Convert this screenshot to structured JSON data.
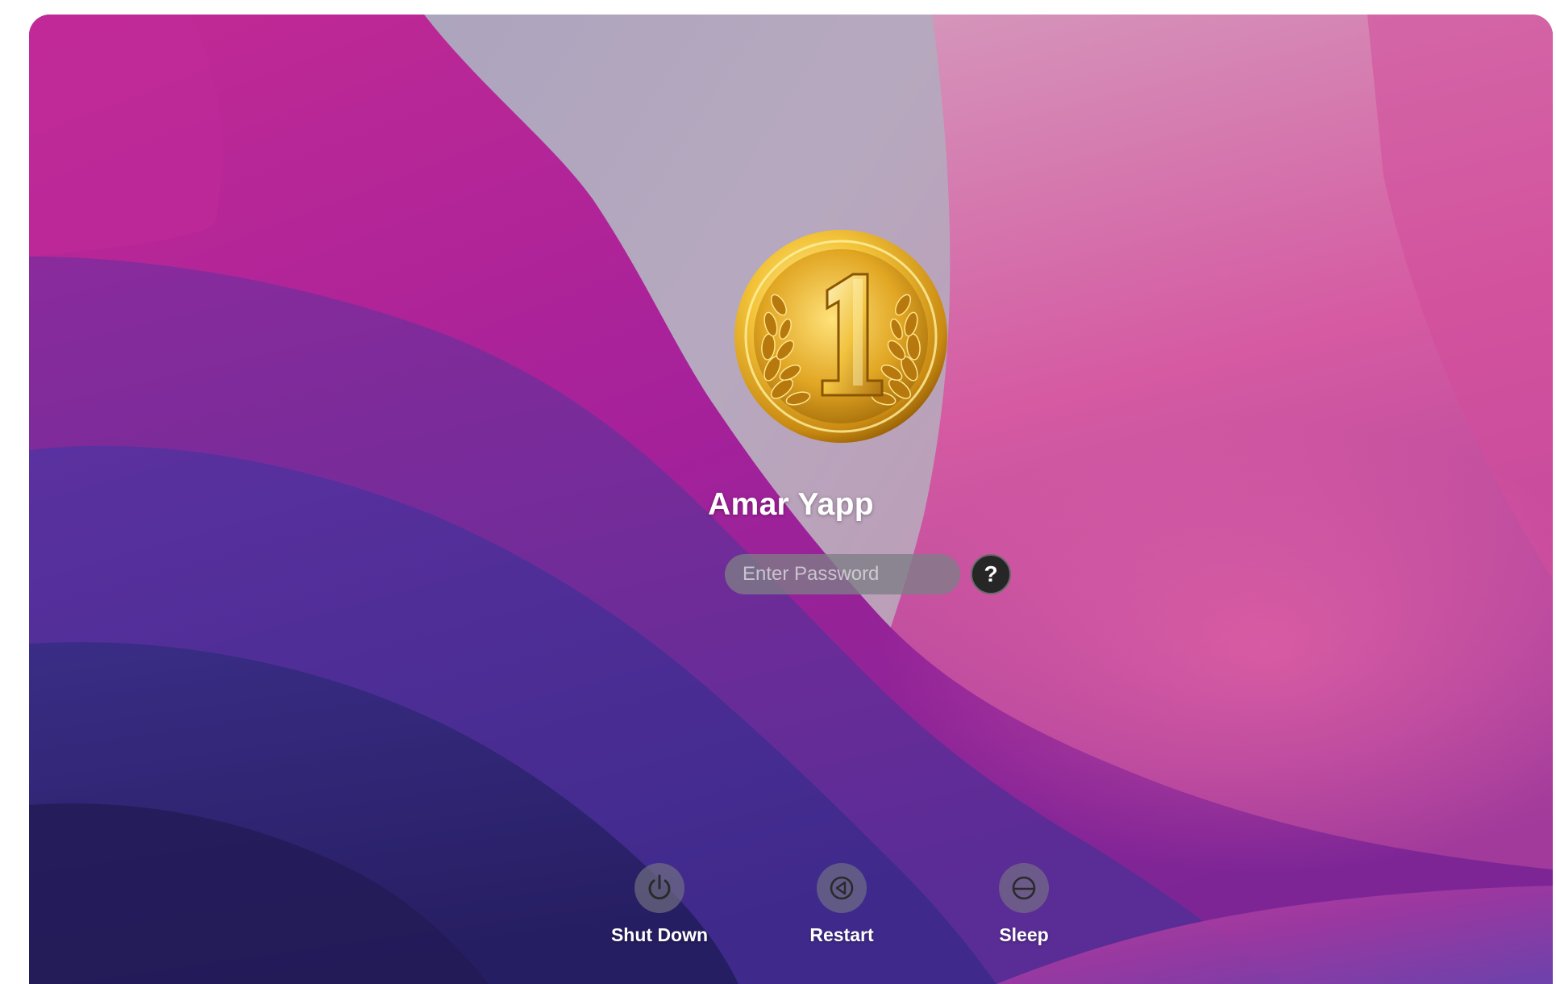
{
  "login": {
    "user_name": "Amar Yapp",
    "avatar_icon": "gold-medal-number-one-icon",
    "password_placeholder": "Enter Password",
    "password_value": "",
    "help_icon": "question-mark-icon",
    "help_glyph": "?"
  },
  "power_actions": [
    {
      "label": "Shut Down",
      "icon": "power-icon"
    },
    {
      "label": "Restart",
      "icon": "restart-icon"
    },
    {
      "label": "Sleep",
      "icon": "sleep-icon"
    }
  ],
  "colors": {
    "wallpaper_top": "#a89bb6",
    "wallpaper_magenta": "#b8229a",
    "wallpaper_pink": "#d34a9c",
    "wallpaper_purple": "#4b2d8f",
    "wallpaper_dark": "#2a1f66",
    "medal_gold": "#e0a520",
    "field_gray": "#7d7d87",
    "text": "#ffffff"
  }
}
